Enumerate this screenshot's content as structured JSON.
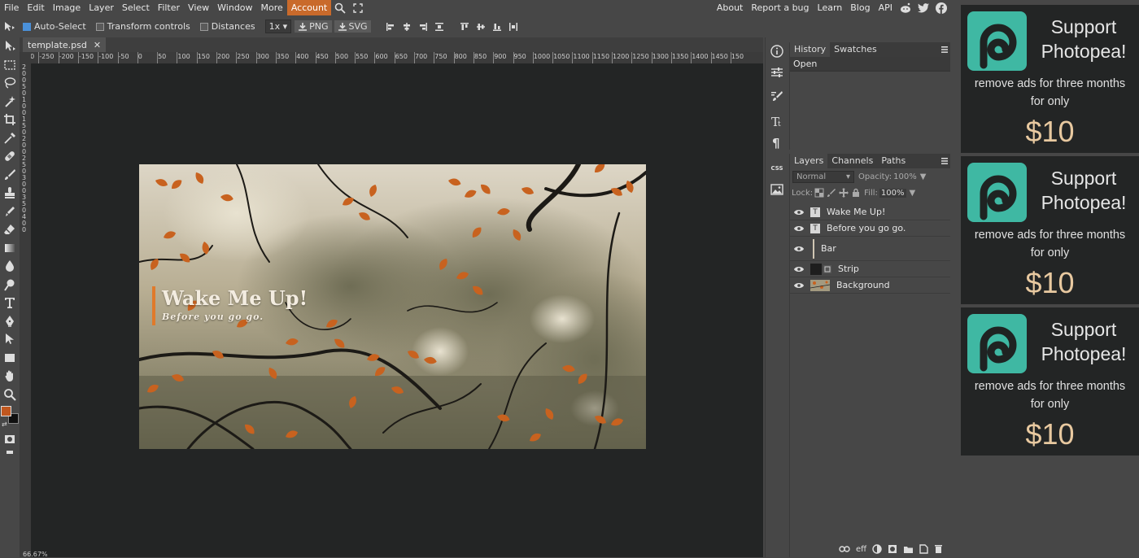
{
  "menu": {
    "left": [
      "File",
      "Edit",
      "Image",
      "Layer",
      "Select",
      "Filter",
      "View",
      "Window",
      "More",
      "Account"
    ],
    "right": [
      "About",
      "Report a bug",
      "Learn",
      "Blog",
      "API"
    ]
  },
  "options": {
    "auto_select": "Auto-Select",
    "transform_controls": "Transform controls",
    "distances": "Distances",
    "scale": "1x",
    "png": "PNG",
    "svg": "SVG"
  },
  "document": {
    "tab_title": "template.psd",
    "close": "✕",
    "zoom": "66.67%",
    "title": "Wake Me Up!",
    "subtitle": "Before you go go.",
    "accent_color": "#e07a2b"
  },
  "ruler": {
    "h_ticks": [
      "-300",
      "-250",
      "-200",
      "-150",
      "-100",
      "-50",
      "0",
      "50",
      "100",
      "150",
      "200",
      "250",
      "300",
      "350",
      "400",
      "450",
      "500",
      "550",
      "600",
      "650",
      "700",
      "750",
      "800",
      "850",
      "900",
      "950",
      "1000",
      "1050",
      "1100",
      "1150",
      "1200",
      "1250",
      "1300",
      "1350",
      "1400",
      "1450",
      "150"
    ],
    "v_ticks": [
      "2",
      "0",
      "0",
      "5",
      "0",
      "1",
      "0",
      "0",
      "1",
      "5",
      "0",
      "2",
      "0",
      "0",
      "2",
      "5",
      "0",
      "3",
      "0",
      "0",
      "3",
      "5",
      "0",
      "4",
      "0",
      "0"
    ]
  },
  "history_panel": {
    "tabs": [
      "History",
      "Swatches"
    ],
    "items": [
      "Open"
    ]
  },
  "layers_panel": {
    "tabs": [
      "Layers",
      "Channels",
      "Paths"
    ],
    "blend_mode": "Normal",
    "opacity_label": "Opacity:",
    "opacity_value": "100%",
    "lock_label": "Lock:",
    "fill_label": "Fill:",
    "fill_value": "100%",
    "layers": [
      {
        "name": "Wake Me Up!",
        "type": "T"
      },
      {
        "name": "Before you go go.",
        "type": "T"
      },
      {
        "name": "Bar",
        "type": "bar"
      },
      {
        "name": "Strip",
        "type": "strip"
      },
      {
        "name": "Background",
        "type": "image"
      }
    ],
    "footer_eff": "eff"
  },
  "midstrip": {
    "css_label": "CSS"
  },
  "ads": [
    {
      "title1": "Support",
      "title2": "Photopea!",
      "line1": "remove ads for three months",
      "line2": "for only",
      "price": "$10"
    },
    {
      "title1": "Support",
      "title2": "Photopea!",
      "line1": "remove ads for three months",
      "line2": "for only",
      "price": "$10"
    },
    {
      "title1": "Support",
      "title2": "Photopea!",
      "line1": "remove ads for three months",
      "line2": "for only",
      "price": "$10"
    }
  ],
  "colors": {
    "accent": "#c96a2b",
    "foreground": "#c0571f",
    "background_swatch": "#101010",
    "logo_teal": "#3fb8a3"
  }
}
